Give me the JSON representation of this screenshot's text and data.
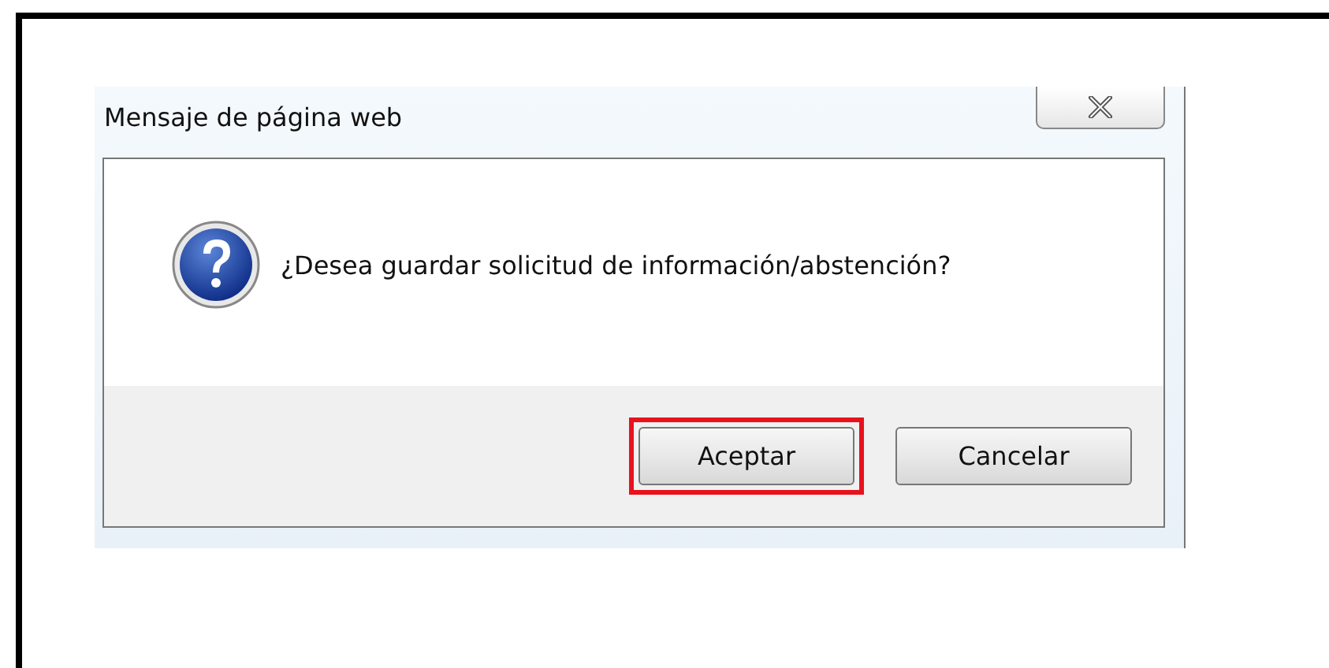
{
  "window": {
    "title": "Mensaje de página web"
  },
  "message": "¿Desea guardar solicitud de información/abstención?",
  "buttons": [
    {
      "label": "Aceptar",
      "highlighted": true
    },
    {
      "label": "Cancelar",
      "highlighted": false
    }
  ]
}
